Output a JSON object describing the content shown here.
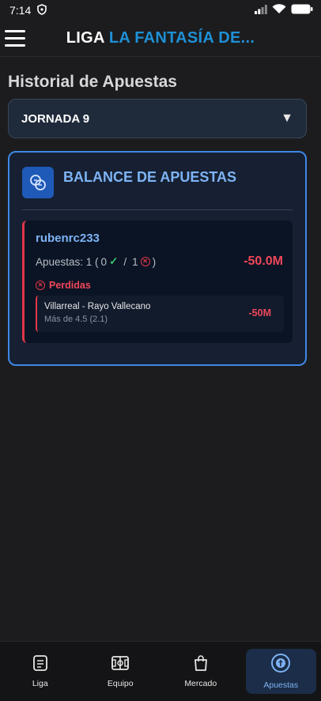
{
  "status_bar": {
    "time": "7:14"
  },
  "app_bar": {
    "title_prefix": "LIGA",
    "title_suffix": "LA FANTASÍA DE..."
  },
  "page": {
    "title": "Historial de Apuestas"
  },
  "round_select": {
    "value": "JORNADA 9"
  },
  "balance": {
    "title": "BALANCE DE APUESTAS",
    "users": [
      {
        "name": "rubenrc233",
        "bets_label": "Apuestas: 1 (",
        "won_count": "0",
        "separator": "/",
        "lost_count": "1",
        "close_paren": ")",
        "total": "-50.0M",
        "lost_section_label": "Perdidas",
        "bets": [
          {
            "match": "Villarreal - Rayo Vallecano",
            "pick": "Más de 4.5 (2.1)",
            "amount": "-50M"
          }
        ]
      }
    ]
  },
  "bottom_nav": {
    "items": [
      {
        "label": "Liga",
        "icon": "document-icon"
      },
      {
        "label": "Equipo",
        "icon": "field-icon"
      },
      {
        "label": "Mercado",
        "icon": "shopping-bag-icon"
      },
      {
        "label": "Apuestas",
        "icon": "bets-icon",
        "active": true
      }
    ]
  },
  "colors": {
    "accent": "#1e90d6",
    "card_border": "#3e88e8",
    "loss": "#f0475a",
    "win": "#36c26a"
  }
}
